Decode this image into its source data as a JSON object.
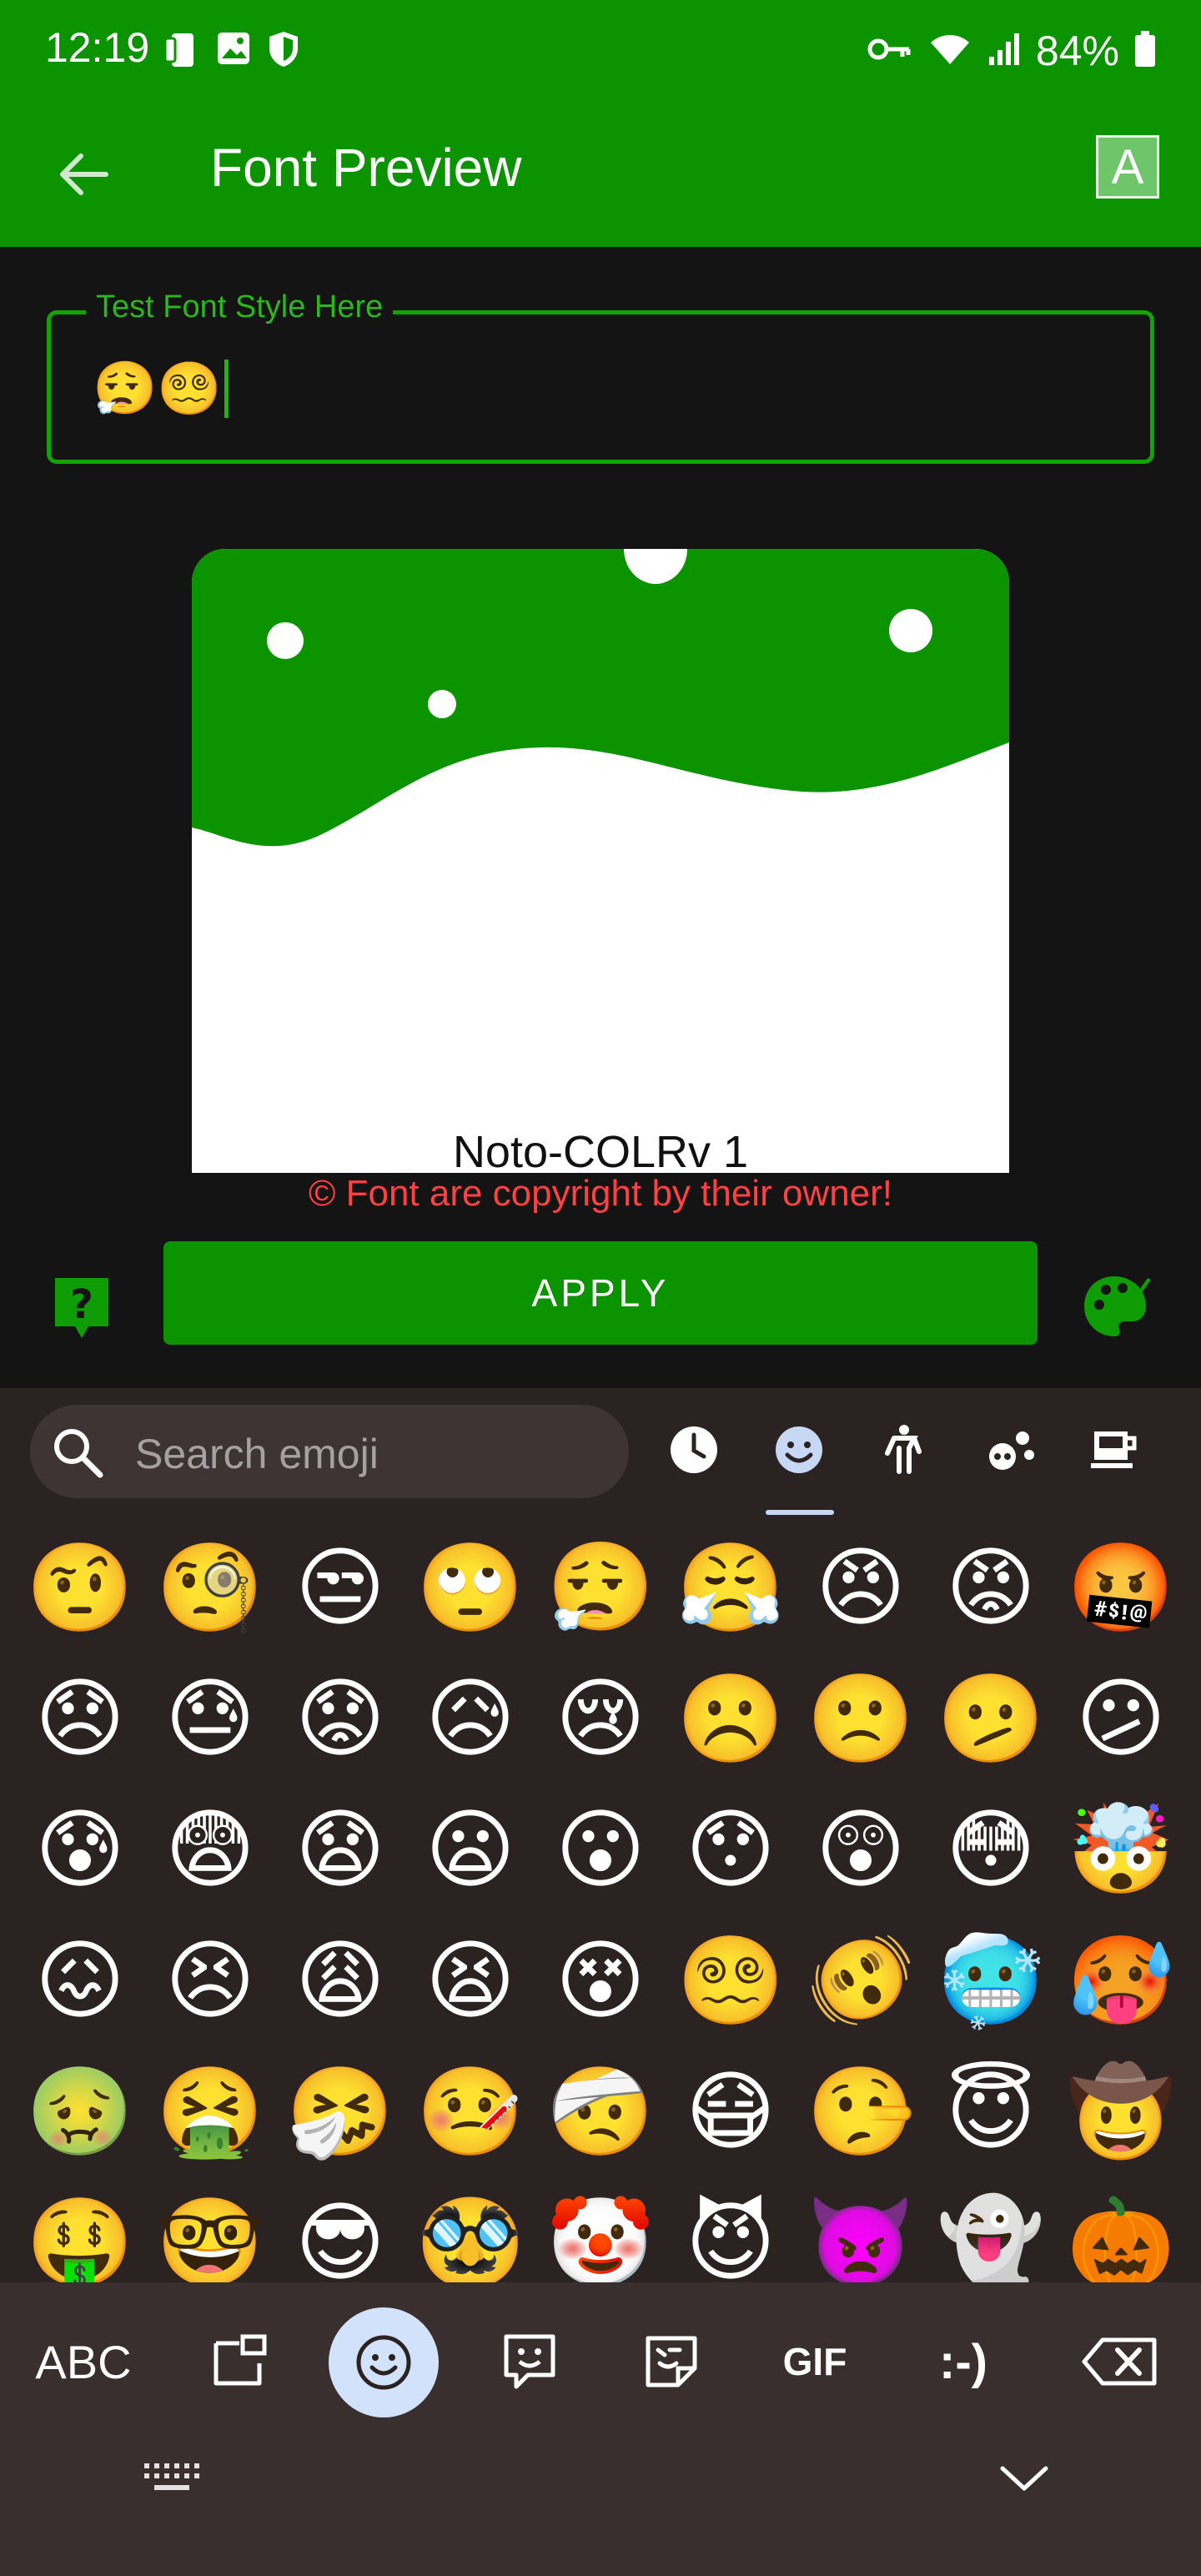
{
  "status_bar": {
    "time": "12:19",
    "battery_percent": "84%",
    "icons_left": [
      "phone-link-icon",
      "gallery-icon",
      "shield-icon"
    ],
    "icons_right": [
      "vpn-key-icon",
      "wifi-icon",
      "signal-icon",
      "battery-icon"
    ]
  },
  "app_bar": {
    "title": "Font Preview",
    "font_button_label": "A",
    "color": "#0b9300"
  },
  "test_field": {
    "label": "Test Font Style Here",
    "value": "😮‍💨😵‍💫"
  },
  "preview": {
    "font_name": "Noto-COLRv 1"
  },
  "copyright_text": "© Font are copyright by their owner!",
  "apply_label": "APPLY",
  "keyboard": {
    "search_placeholder": "Search emoji",
    "categories": [
      "recent-icon",
      "smiley-icon",
      "people-icon",
      "animals-icon",
      "food-icon"
    ],
    "active_category": "smiley-icon",
    "emoji_rows": [
      [
        "🤨",
        "🧐",
        "😒",
        "🙄",
        "😮‍💨",
        "😤",
        "😠",
        "😡",
        "🤬"
      ],
      [
        "😞",
        "😓",
        "😟",
        "😥",
        "😢",
        "☹️",
        "🙁",
        "🫤",
        "😕"
      ],
      [
        "😰",
        "😨",
        "😧",
        "😦",
        "😮",
        "😯",
        "😲",
        "😳",
        "🤯"
      ],
      [
        "😖",
        "😣",
        "😩",
        "😫",
        "😵",
        "😵‍💫",
        "🫨",
        "🥶",
        "🥵"
      ],
      [
        "🤢",
        "🤮",
        "🤧",
        "🤒",
        "🤕",
        "😷",
        "🤥",
        "😇",
        "🤠"
      ],
      [
        "🤑",
        "🤓",
        "😎",
        "🥸",
        "🤡",
        "😈",
        "👿",
        "👻",
        "🎃"
      ]
    ],
    "bottom_row": {
      "abc": "ABC",
      "gif": "GIF",
      "emoticon": ":-)"
    }
  }
}
